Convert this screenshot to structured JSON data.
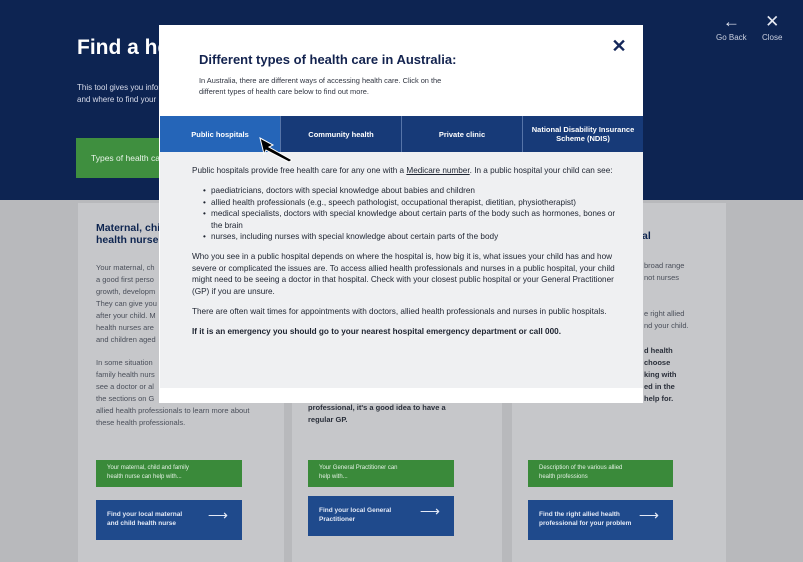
{
  "background": {
    "title": "Find a he",
    "intro_text": "This tool gives you infor\nand where to find your",
    "tab_button": "Types of health ca",
    "nav": {
      "go_back": "Go Back",
      "close": "Close"
    },
    "cards": [
      {
        "heading": "Maternal, chi\nhealth nurse",
        "text": "Your maternal, ch\na good first perso\ngrowth, developm\nThey can give you\nafter your child. M\nhealth nurses are\nand children aged",
        "text2": "In some situation\nfamily health nurs\nsee a doctor or al\nthe sections on G\nallied health professionals to learn more about\nthese health professionals.",
        "green_button": "Your maternal, child and family\nhealth nurse can help with...",
        "blue_button": "Find your local maternal\nand child health nurse"
      },
      {
        "bold_text": "professional, it's a good idea to have a\nregular GP.",
        "green_button": "Your General Practitioner can\nhelp with...",
        "blue_button": "Find your local General\nPractitioner"
      },
      {
        "heading": "al",
        "text": "broad range\nnot nurses",
        "text2": "e right allied\nnd your child.",
        "bold_text": "d health\nchoose\nking with\ned in the\n help for.",
        "green_button": "Description of the various allied\nhealth professions",
        "blue_button": "Find the right allied health\nprofessional for your problem"
      }
    ]
  },
  "modal": {
    "title": "Different types of health care in Australia:",
    "intro": "In Australia, there are different ways of accessing health care. Click on the different types of health care below to find out more.",
    "tabs": [
      {
        "label": "Public hospitals",
        "active": true
      },
      {
        "label": "Community health",
        "active": false
      },
      {
        "label": "Private clinic",
        "active": false
      },
      {
        "label": "National Disability Insurance Scheme (NDIS)",
        "active": false
      }
    ],
    "panel": {
      "p1_before": "Public hospitals provide free health care for any one with a ",
      "p1_link": "Medicare number",
      "p1_after": ". In a public hospital your child can see:",
      "bullets": [
        "paediatricians, doctors with special knowledge about babies and children",
        "allied health professionals (e.g., speech pathologist, occupational therapist, dietitian, physiotherapist)",
        "medical specialists, doctors with special knowledge about certain parts of the body such as hormones, bones or the brain",
        "nurses, including nurses with special knowledge about certain parts of the body"
      ],
      "p2": "Who you see in a public hospital depends on where the hospital is, how big it is, what issues your child has and how severe or complicated the issues are. To access allied health professionals and nurses in a public hospital, your child might need to be seeing a doctor in that hospital. Check with your closest public hospital or your General Practitioner (GP) if you are unsure.",
      "p3": "There are often wait times for appointments with doctors, allied health professionals and nurses in public hospitals.",
      "p4": "If it is an emergency you should go to your nearest hospital emergency department or call 000."
    }
  },
  "icons": {
    "close": "close-icon",
    "go_back": "arrow-left-icon",
    "cursor": "mouse-pointer-icon"
  },
  "colors": {
    "header_navy": "#0d2452",
    "tab_navy": "#173a78",
    "tab_active": "#2565b8",
    "green": "#3a8a3a",
    "button_blue": "#1f4a8c"
  }
}
